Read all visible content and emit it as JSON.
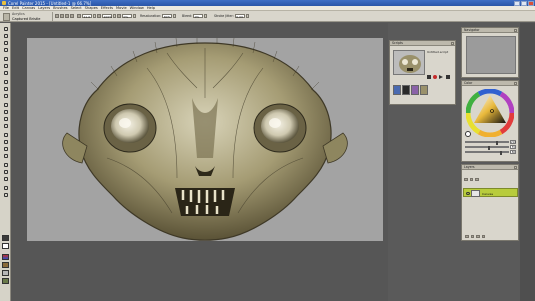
{
  "window": {
    "title": "Corel Painter 2015 - [Untitled-1 @ 66.7%]"
  },
  "menu": [
    "File",
    "Edit",
    "Canvas",
    "Layers",
    "Brushes",
    "Select",
    "Shapes",
    "Effects",
    "Movie",
    "Window",
    "Help"
  ],
  "property_bar": {
    "brush_category": "Acrylics",
    "brush_variant": "Captured Bristle",
    "size_label": "",
    "size_value": "11.0",
    "opacity_value": "100%",
    "grain_value": "0%",
    "resaturation_label": "Resaturation:",
    "resaturation_value": "80%",
    "bleed_label": "Bleed:",
    "bleed_value": "0%",
    "stroke_jitter_label": "Stroke Jitter:",
    "stroke_jitter_value": "0.00"
  },
  "panels": {
    "scripts": {
      "title": "Scripts",
      "script_name": "Untitled.script"
    },
    "navigator": {
      "title": "Navigator"
    },
    "color": {
      "title": "Color",
      "hue": "210",
      "saturation": "55",
      "value": "80"
    },
    "layers": {
      "title": "Layers",
      "layer_name": "Canvas"
    }
  },
  "colors": {
    "canvas_gray": "#a3a3a3",
    "workspace_gray": "#565656",
    "panel_bg": "#d9d6cc",
    "layer_highlight": "#b8cc3c",
    "title_blue": "#2a56a8"
  },
  "icons": [
    "brush-icon",
    "hand-icon",
    "zoom-icon",
    "eyedropper-icon",
    "lasso-icon",
    "eraser-icon",
    "record-icon",
    "stop-icon",
    "play-icon",
    "eye-icon",
    "close-icon"
  ]
}
